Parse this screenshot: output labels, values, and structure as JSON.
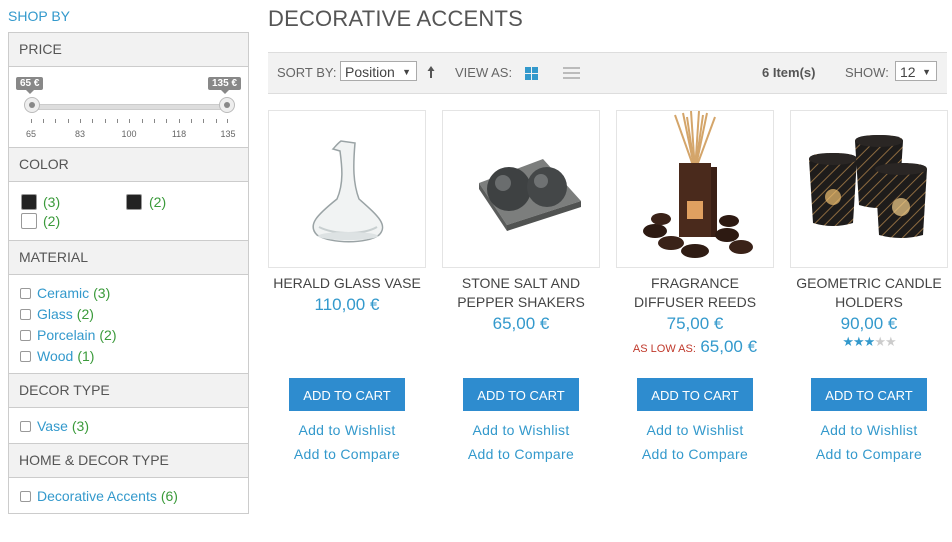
{
  "sidebar": {
    "heading": "SHOP BY",
    "price": {
      "label": "PRICE",
      "min_value": "65 €",
      "max_value": "135 €",
      "ticks": [
        "65",
        "83",
        "100",
        "118",
        "135"
      ]
    },
    "color": {
      "label": "COLOR",
      "swatches": [
        {
          "color": "#222222",
          "count": "(3)"
        },
        {
          "color": "#222222",
          "count": "(2)"
        },
        {
          "color": "#ffffff",
          "count": "(2)"
        }
      ]
    },
    "material": {
      "label": "MATERIAL",
      "items": [
        {
          "label": "Ceramic",
          "count": "(3)"
        },
        {
          "label": "Glass",
          "count": "(2)"
        },
        {
          "label": "Porcelain",
          "count": "(2)"
        },
        {
          "label": "Wood",
          "count": "(1)"
        }
      ]
    },
    "decor_type": {
      "label": "DECOR TYPE",
      "items": [
        {
          "label": "Vase",
          "count": "(3)"
        }
      ]
    },
    "home_decor_type": {
      "label": "HOME & DECOR TYPE",
      "items": [
        {
          "label": "Decorative Accents",
          "count": "(6)"
        }
      ]
    }
  },
  "main": {
    "title": "DECORATIVE ACCENTS",
    "toolbar": {
      "sort_label": "SORT BY:",
      "sort_value": "Position",
      "view_label": "VIEW AS:",
      "item_count": "6 Item(s)",
      "show_label": "SHOW:",
      "show_value": "12"
    },
    "products": [
      {
        "name": "HERALD GLASS VASE",
        "price": "110,00 €",
        "add_to_cart": "ADD TO CART",
        "wishlist": "Add to Wishlist",
        "compare": "Add to Compare"
      },
      {
        "name": "STONE SALT AND PEPPER SHAKERS",
        "price": "65,00 €",
        "add_to_cart": "ADD TO CART",
        "wishlist": "Add to Wishlist",
        "compare": "Add to Compare"
      },
      {
        "name": "FRAGRANCE DIFFUSER REEDS",
        "price": "75,00 €",
        "as_low_as_label": "AS LOW AS:",
        "as_low_as_price": "65,00 €",
        "add_to_cart": "ADD TO CART",
        "wishlist": "Add to Wishlist",
        "compare": "Add to Compare"
      },
      {
        "name": "GEOMETRIC CANDLE HOLDERS",
        "price": "90,00 €",
        "rating_stars": 3,
        "rating_max": 5,
        "add_to_cart": "ADD TO CART",
        "wishlist": "Add to Wishlist",
        "compare": "Add to Compare"
      }
    ]
  },
  "colors": {
    "accent": "#3399cc",
    "button": "#2e8ccf",
    "count_green": "#3a9a3a",
    "as_low_red": "#c0392b"
  }
}
